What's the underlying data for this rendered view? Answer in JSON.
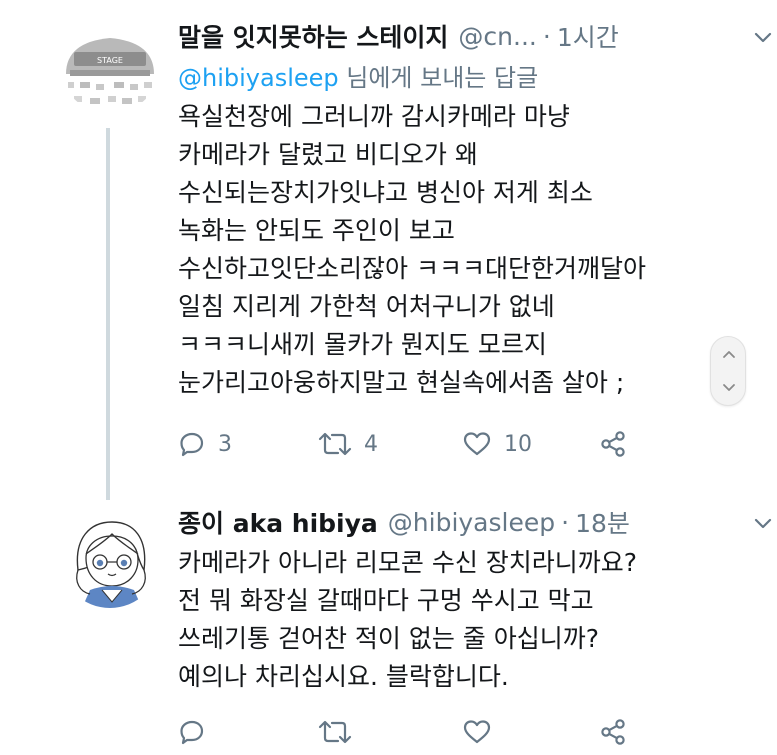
{
  "tweets": [
    {
      "display_name": "말을 잇지못하는 스테이지",
      "handle": "@cn...",
      "separator": "·",
      "time": "1시간",
      "reply_to_link": "@hibiyasleep",
      "reply_to_suffix": " 님에게 보내는 답글",
      "avatar_label": "STAGE",
      "avatar_icon": "stage-seat-map",
      "lines": [
        "욕실천장에 그러니까 감시카메라 마냥",
        "카메라가 달렸고 비디오가 왜",
        "수신되는장치가잇냐고 병신아 저게 최소",
        "녹화는 안되도 주인이 보고",
        "수신하고잇단소리잖아 ㅋㅋㅋ대단한거깨달아",
        "일침 지리게 가한척 어처구니가 없네",
        "ㅋㅋㅋ니새끼 몰카가 뭔지도 모르지",
        "눈가리고아웅하지말고 현실속에서좀 살아 ;"
      ],
      "actions": {
        "reply": "3",
        "retweet": "4",
        "like": "10"
      }
    },
    {
      "display_name": "종이 aka hibiya",
      "handle": "@hibiyasleep",
      "separator": "·",
      "time": "18분",
      "avatar_icon": "anime-girl-portrait",
      "lines": [
        "카메라가 아니라 리모콘 수신 장치라니까요?",
        "전 뭐 화장실 갈때마다 구멍 쑤시고 막고",
        "쓰레기통 걷어찬 적이 없는 줄 아십니까?",
        "예의나 차리십시요. 블락합니다."
      ],
      "actions": {
        "reply": "",
        "retweet": "",
        "like": ""
      }
    }
  ],
  "colors": {
    "text": "#14171a",
    "muted": "#657786",
    "link": "#1da1f2",
    "thread_line": "#cfd9de"
  },
  "icons": [
    "reply-icon",
    "retweet-icon",
    "like-icon",
    "share-icon",
    "chevron-down-icon",
    "scroll-up-icon",
    "scroll-down-icon"
  ]
}
